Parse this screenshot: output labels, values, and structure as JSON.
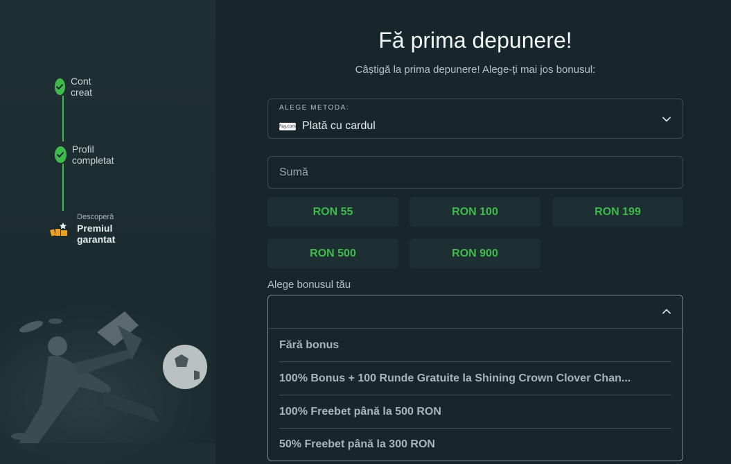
{
  "steps": [
    {
      "label": "Cont creat",
      "status": "done"
    },
    {
      "label": "Profil completat",
      "status": "done"
    }
  ],
  "reward": {
    "small": "Descoperă",
    "big": "Premiul garantat"
  },
  "main": {
    "title": "Fă prima depunere!",
    "subtitle": "Câștigă la prima depunere! Alege-ți mai jos bonusul:"
  },
  "method": {
    "caption": "ALEGE METODA:",
    "logo_text": "Pay.com",
    "value": "Plată cu cardul"
  },
  "amount": {
    "placeholder": "Sumă"
  },
  "chips": [
    "RON 55",
    "RON 100",
    "RON 199",
    "RON 500",
    "RON 900"
  ],
  "bonus": {
    "label": "Alege bonusul tău",
    "options": [
      "Fără bonus",
      "100% Bonus + 100 Runde Gratuite la Shining Crown Clover Chan...",
      "100% Freebet până la 500 RON",
      "50% Freebet până la 300 RON"
    ]
  },
  "colors": {
    "accent": "#3fbb4c",
    "background": "#17262b",
    "sidebar": "#1f3033"
  }
}
